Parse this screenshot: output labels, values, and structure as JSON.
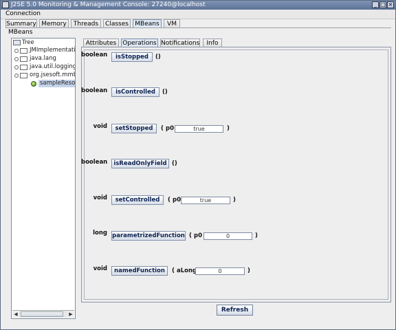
{
  "window": {
    "title": "J2SE 5.0 Monitoring & Management Console: 27240@localhost"
  },
  "menu": {
    "connection": "Connection"
  },
  "main_tabs": [
    "Summary",
    "Memory",
    "Threads",
    "Classes",
    "MBeans",
    "VM"
  ],
  "selected_main_tab": "MBeans",
  "section_label": "MBeans",
  "tree": {
    "root": "Tree",
    "nodes": [
      "JMImplementation",
      "java.lang",
      "java.util.logging",
      "org.jsesoft.mmbi.S",
      "sampleResourc"
    ]
  },
  "inner_tabs": [
    "Attributes",
    "Operations",
    "Notifications",
    "Info"
  ],
  "selected_inner_tab": "Operations",
  "operations": [
    {
      "return_type": "boolean",
      "name": "isStopped",
      "open": "()",
      "param": "",
      "value": "",
      "close": ""
    },
    {
      "return_type": "boolean",
      "name": "isControlled",
      "open": "()",
      "param": "",
      "value": "",
      "close": ""
    },
    {
      "return_type": "void",
      "name": "setStopped",
      "open": "(",
      "param": "p0",
      "value": "true",
      "close": ")"
    },
    {
      "return_type": "boolean",
      "name": "isReadOnlyField",
      "open": "()",
      "param": "",
      "value": "",
      "close": ""
    },
    {
      "return_type": "void",
      "name": "setControlled",
      "open": "(",
      "param": "p0",
      "value": "true",
      "close": ")"
    },
    {
      "return_type": "long",
      "name": "parametrizedFunction",
      "open": "(",
      "param": "p0",
      "value": "0",
      "close": ")"
    },
    {
      "return_type": "void",
      "name": "namedFunction",
      "open": "(",
      "param": "aLong",
      "value": "0",
      "close": ")"
    }
  ],
  "buttons": {
    "refresh": "Refresh"
  },
  "icons": {
    "title": "console-icon",
    "minimize": "minimize-icon",
    "maximize": "maximize-icon",
    "close": "close-icon",
    "tree_root": "tree-root-icon",
    "package": "folder-icon",
    "mbean": "mbean-icon"
  },
  "colors": {
    "titlebar": "#5d7398",
    "button_text": "#0b2150",
    "selected_tab": "#dde8f4"
  }
}
